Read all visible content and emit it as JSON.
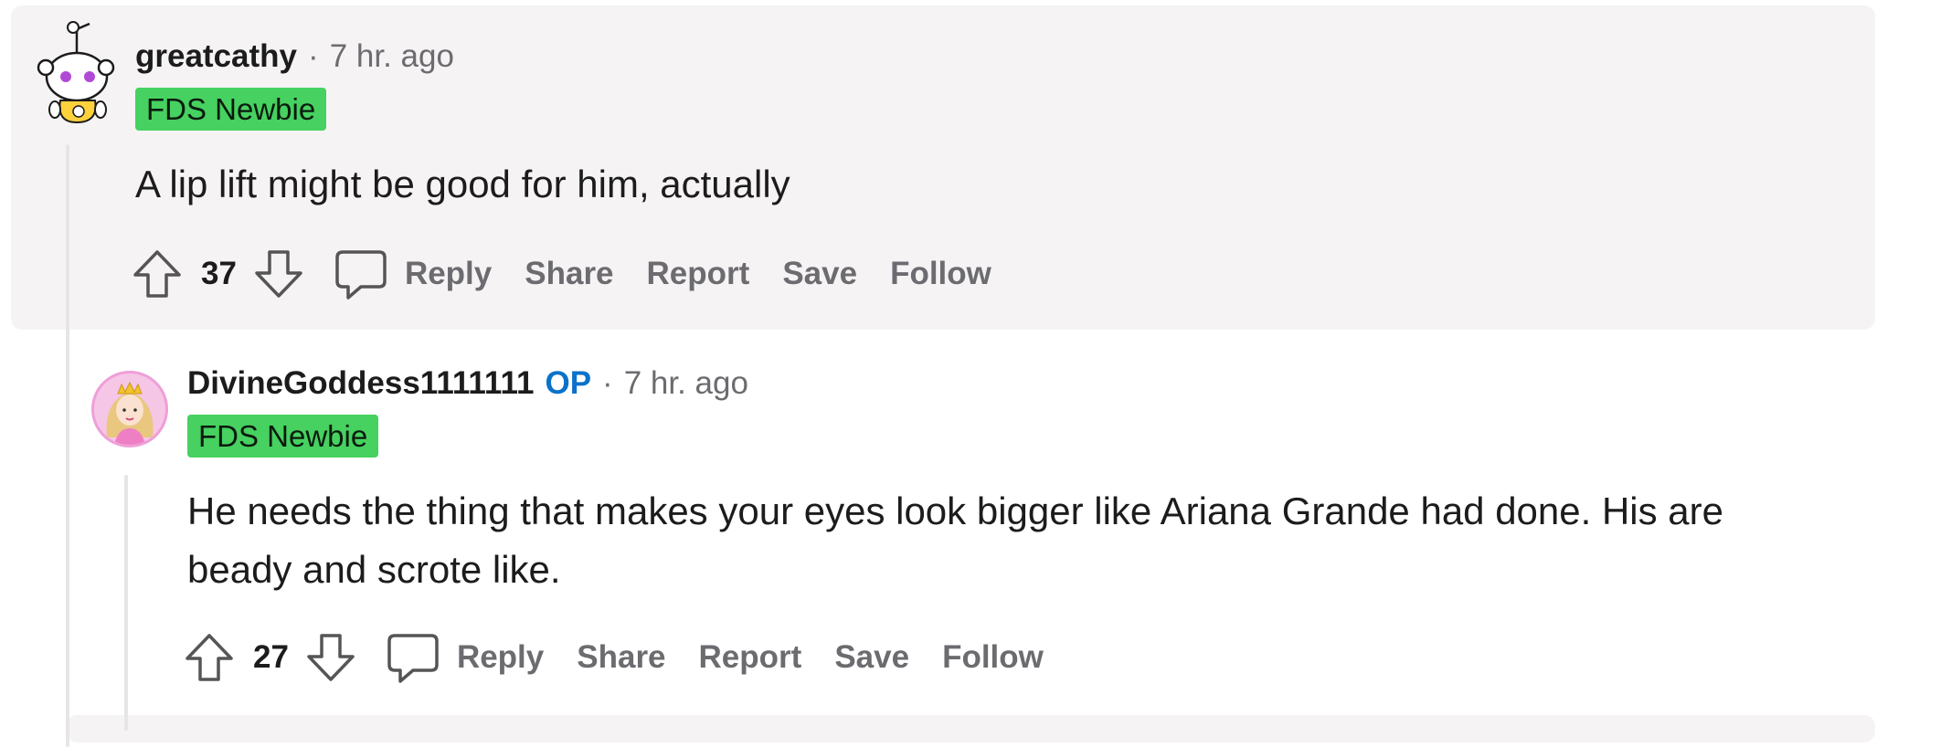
{
  "comments": [
    {
      "username": "greatcathy",
      "separator": "·",
      "time": "7 hr. ago",
      "flair": "FDS Newbie",
      "body": "A lip lift might be good for him, actually",
      "score": "37",
      "actions": {
        "reply": "Reply",
        "share": "Share",
        "report": "Report",
        "save": "Save",
        "follow": "Follow"
      }
    },
    {
      "username": "DivineGoddess1111111",
      "op_badge": "OP",
      "separator": "·",
      "time": "7 hr. ago",
      "flair": "FDS Newbie",
      "body_line1": "He needs the thing that makes your eyes look bigger like Ariana Grande had done. His are",
      "body_line2": "beady and scrote like.",
      "score": "27",
      "actions": {
        "reply": "Reply",
        "share": "Share",
        "report": "Report",
        "save": "Save",
        "follow": "Follow"
      }
    }
  ],
  "icons": [
    "upvote-icon",
    "downvote-icon",
    "comment-bubble-icon"
  ],
  "colors": {
    "flair_bg": "#46d160",
    "op_blue": "#0a72c9",
    "card_bg": "#f6f3f4",
    "meta_gray": "#6c6c70"
  }
}
